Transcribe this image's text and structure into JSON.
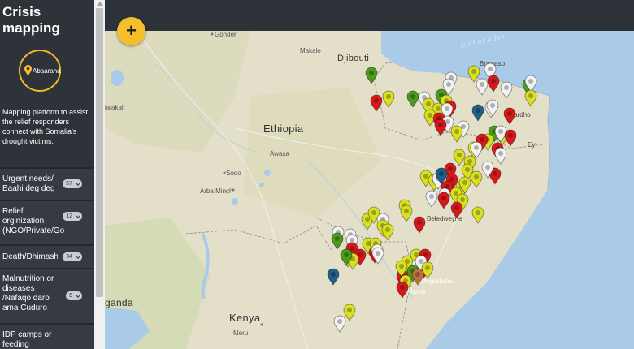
{
  "app": {
    "title": "Crisis mapping",
    "logo_text": "Abaaraha",
    "description": "Mapping platform to assist the relief responders connect with Somalia's drought victims."
  },
  "categories": [
    {
      "label": "Urgent needs/ Baahi deg deg",
      "count": "57"
    },
    {
      "label": "Relief orginization (NGO/Private/Go",
      "count": "12"
    },
    {
      "label": "Death/Dhimasho",
      "count": "34"
    },
    {
      "label": "Malnutrition or diseases /Nafaqo daro ama Cuduro",
      "count": "5"
    },
    {
      "label": "IDP camps or feeding",
      "count": ""
    }
  ],
  "map": {
    "add_button": "+",
    "labels": {
      "ethiopia": "Ethiopia",
      "djibouti": "Djibouti",
      "kenya": "Kenya",
      "uganda": "ganda",
      "gulf": "Gulf of Aden",
      "gonder": "Gonder",
      "makale": "Makale",
      "lalakal": "lalakal",
      "awasa": "Awasa",
      "sodo": "Sodo",
      "arba_minch": "Arba Minch",
      "meru": "Meru",
      "bosaaso": "Bosaaso",
      "qardho": "Qardho",
      "eyl": "Eyl",
      "beledweyne": "Beledweyne",
      "mogadishu": "Mogadishu",
      "marka": "Marka"
    }
  },
  "colors": {
    "pin_yellow": "#d9e021",
    "pin_red": "#d7191c",
    "pin_green": "#4d9b1d",
    "pin_white": "#f2f2f2",
    "pin_blue": "#1f5f8b",
    "pin_brown": "#b8733c",
    "accent": "#f5bf2b",
    "sea": "#a9cbe7"
  },
  "icons": {
    "add": "plus-icon",
    "logo": "map-pin-icon",
    "dropdown": "chevron-down-icon"
  }
}
